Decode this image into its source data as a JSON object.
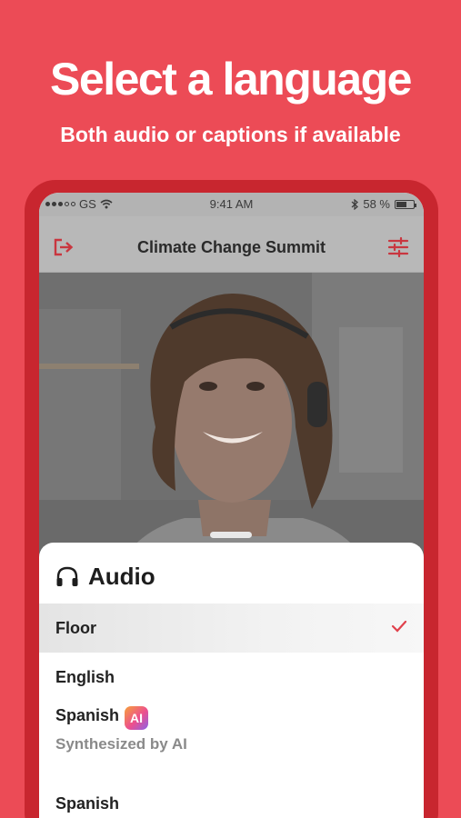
{
  "promo": {
    "headline": "Select a language",
    "subheadline": "Both audio or captions if available"
  },
  "status_bar": {
    "carrier": "GS",
    "time": "9:41 AM",
    "battery": "58 %"
  },
  "nav": {
    "title": "Climate Change Summit",
    "left_icon": "exit-icon",
    "right_icon": "filter-icon"
  },
  "sheet": {
    "title": "Audio",
    "icon": "headphones-icon",
    "options": [
      {
        "label": "Floor",
        "selected": true
      },
      {
        "label": "English",
        "selected": false
      },
      {
        "label": "Spanish",
        "badge": "AI",
        "sublabel": "Synthesized by AI",
        "selected": false
      },
      {
        "label": "Spanish",
        "selected": false
      }
    ]
  },
  "colors": {
    "brand": "#ec4b56",
    "phone_frame": "#c8262f",
    "check": "#e0414c"
  }
}
